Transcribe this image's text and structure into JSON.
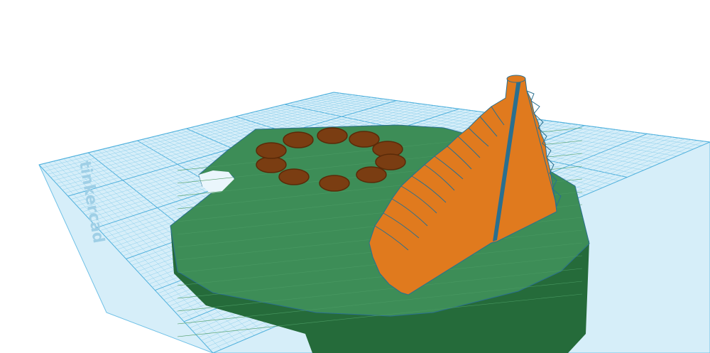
{
  "workplane": {
    "watermark": "tinkercad",
    "grid_color": "#8fd0ec",
    "grid_major_color": "#4fb0dc",
    "plane_fill": "#d6eef9"
  },
  "model": {
    "base_color": "#2e7d46",
    "base_top_color": "#3d8d57",
    "hole_count": 10,
    "hole_color": "#7a3d12",
    "hole_rim_color": "#5a2a08",
    "staircase_color": "#e07a1e",
    "staircase_shadow": "#c9681a",
    "edge_color": "#2a6f8f"
  }
}
